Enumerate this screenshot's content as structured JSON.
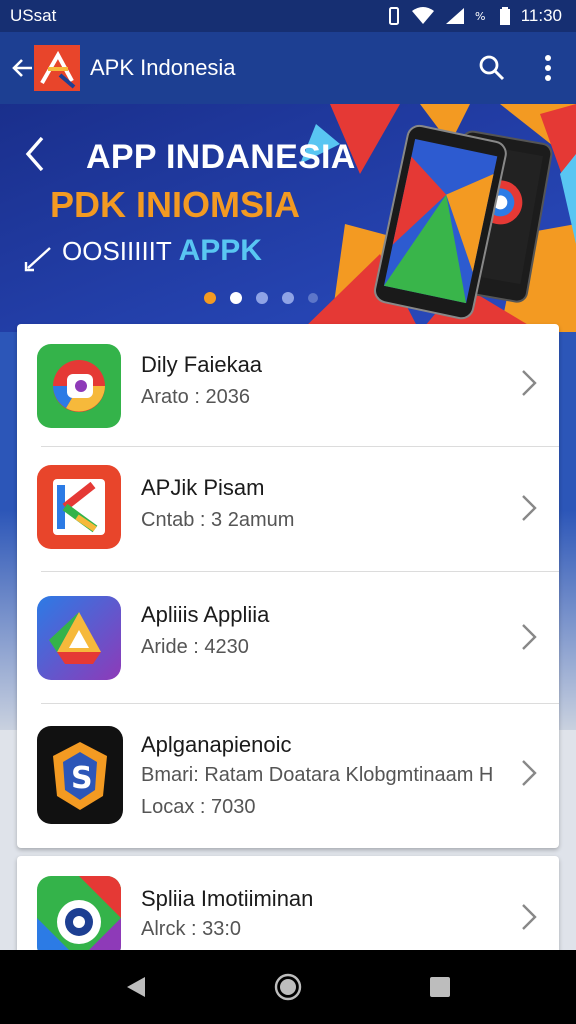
{
  "status_bar": {
    "carrier": "USsat",
    "time": "11:30"
  },
  "app_bar": {
    "title": "APK Indonesia",
    "icons": [
      "back-arrow-icon",
      "apk-logo",
      "search-icon",
      "more-vert-icon"
    ]
  },
  "banner": {
    "line1": "APP INDANESIA",
    "line2": "PDK INIOMSIA",
    "line3_prefix": "OOSIIIIIT",
    "line3_highlight": "APPK",
    "carousel_dots": 5,
    "active_dot": 2
  },
  "apps": [
    {
      "name": "Dily Faiekaa",
      "sub": "Arato : 2036",
      "icon": "green-app-icon"
    },
    {
      "name": "APJik Pisam",
      "sub": "Cntab : 3 2amum",
      "icon": "red-k-app-icon"
    },
    {
      "name": "Apliiis Appliia",
      "sub": "Aride : 4230",
      "icon": "drive-app-icon"
    },
    {
      "name": "Aplganapienoic",
      "sub": "Bmari: Ratam Doatara Klobgmtinaam H",
      "sub2": "Locax : 7030",
      "icon": "s-shield-app-icon"
    },
    {
      "name": "Spliia Imotiiminan",
      "sub": "Alrck : 33:0",
      "icon": "aperture-app-icon"
    }
  ],
  "colors": {
    "status_bar": "#162f72",
    "app_bar": "#1d3f92",
    "banner_blue": "#1f3fa5",
    "banner_orange": "#f39a22",
    "banner_cyan": "#59c6f2"
  }
}
